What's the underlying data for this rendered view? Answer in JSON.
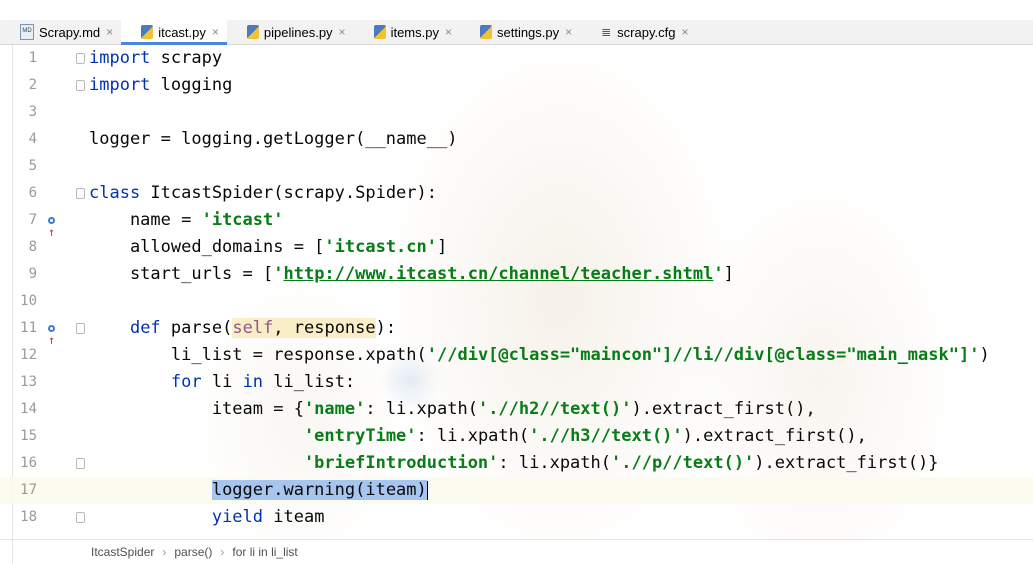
{
  "tabs": [
    {
      "label": "Scrapy.md",
      "icon": "markdown-file-icon",
      "icon_text": "MD",
      "active": false
    },
    {
      "label": "itcast.py",
      "icon": "python-file-icon",
      "active": true
    },
    {
      "label": "pipelines.py",
      "icon": "python-file-icon",
      "active": false
    },
    {
      "label": "items.py",
      "icon": "python-file-icon",
      "active": false
    },
    {
      "label": "settings.py",
      "icon": "python-file-icon",
      "active": false
    },
    {
      "label": "scrapy.cfg",
      "icon": "config-file-icon",
      "icon_text": "≣",
      "active": false
    }
  ],
  "tab_close_glyph": "×",
  "editor": {
    "lines": [
      {
        "num": "1",
        "parts": [
          {
            "t": "import",
            "c": "kw"
          },
          {
            "t": " scrapy",
            "c": ""
          }
        ]
      },
      {
        "num": "2",
        "parts": [
          {
            "t": "import",
            "c": "kw"
          },
          {
            "t": " logging",
            "c": ""
          }
        ]
      },
      {
        "num": "3",
        "parts": []
      },
      {
        "num": "4",
        "parts": [
          {
            "t": "logger = logging.getLogger(__name__)",
            "c": ""
          }
        ]
      },
      {
        "num": "5",
        "parts": []
      },
      {
        "num": "6",
        "parts": [
          {
            "t": "class",
            "c": "kw"
          },
          {
            "t": " ItcastSpider(scrapy.Spider):",
            "c": ""
          }
        ]
      },
      {
        "num": "7",
        "parts": [
          {
            "t": "    name = ",
            "c": ""
          },
          {
            "t": "'itcast'",
            "c": "str"
          }
        ]
      },
      {
        "num": "8",
        "parts": [
          {
            "t": "    allowed_domains = [",
            "c": ""
          },
          {
            "t": "'itcast.cn'",
            "c": "str"
          },
          {
            "t": "]",
            "c": ""
          }
        ]
      },
      {
        "num": "9",
        "parts": [
          {
            "t": "    start_urls = [",
            "c": ""
          },
          {
            "t": "'",
            "c": "str"
          },
          {
            "t": "http://www.itcast.cn/channel/teacher.shtml",
            "c": "url"
          },
          {
            "t": "'",
            "c": "str"
          },
          {
            "t": "]",
            "c": ""
          }
        ]
      },
      {
        "num": "10",
        "parts": []
      },
      {
        "num": "11",
        "parts": [
          {
            "t": "    ",
            "c": ""
          },
          {
            "t": "def",
            "c": "kw"
          },
          {
            "t": " parse(",
            "c": ""
          },
          {
            "t": "self",
            "c": "selfp"
          },
          {
            "t": ", response",
            "c": "param"
          },
          {
            "t": "):",
            "c": ""
          }
        ]
      },
      {
        "num": "12",
        "parts": [
          {
            "t": "        li_list = response.xpath(",
            "c": ""
          },
          {
            "t": "'//div[@class=\"maincon\"]//li//div[@class=\"main_mask\"]'",
            "c": "str"
          },
          {
            "t": ")",
            "c": ""
          }
        ]
      },
      {
        "num": "13",
        "parts": [
          {
            "t": "        ",
            "c": ""
          },
          {
            "t": "for",
            "c": "kw"
          },
          {
            "t": " li ",
            "c": ""
          },
          {
            "t": "in",
            "c": "kw"
          },
          {
            "t": " li_list:",
            "c": ""
          }
        ]
      },
      {
        "num": "14",
        "parts": [
          {
            "t": "            iteam = {",
            "c": ""
          },
          {
            "t": "'name'",
            "c": "str"
          },
          {
            "t": ": li.xpath(",
            "c": ""
          },
          {
            "t": "'.//h2//text()'",
            "c": "str"
          },
          {
            "t": ").extract_first(),",
            "c": ""
          }
        ]
      },
      {
        "num": "15",
        "parts": [
          {
            "t": "                     ",
            "c": ""
          },
          {
            "t": "'entryTime'",
            "c": "str"
          },
          {
            "t": ": li.xpath(",
            "c": ""
          },
          {
            "t": "'.//h3//text()'",
            "c": "str"
          },
          {
            "t": ").extract_first(),",
            "c": ""
          }
        ]
      },
      {
        "num": "16",
        "parts": [
          {
            "t": "                     ",
            "c": ""
          },
          {
            "t": "'briefIntroduction'",
            "c": "str"
          },
          {
            "t": ": li.xpath(",
            "c": ""
          },
          {
            "t": "'.//p//text()'",
            "c": "str"
          },
          {
            "t": ").extract_first()}",
            "c": ""
          }
        ]
      },
      {
        "num": "17",
        "parts": [
          {
            "t": "            ",
            "c": ""
          },
          {
            "t": "logger.warning(iteam)",
            "c": "sel"
          }
        ],
        "current": true,
        "caret": true
      },
      {
        "num": "18",
        "parts": [
          {
            "t": "            ",
            "c": ""
          },
          {
            "t": "yield",
            "c": "kw"
          },
          {
            "t": " iteam",
            "c": ""
          }
        ]
      }
    ],
    "markers": [
      {
        "line": "7",
        "icon": "override-method-icon",
        "glyph": "↑"
      },
      {
        "line": "11",
        "icon": "override-method-icon",
        "glyph": "↑"
      }
    ],
    "folds": [
      "1",
      "2",
      "6",
      "11",
      "16",
      "18"
    ]
  },
  "breadcrumb": [
    "ItcastSpider",
    "parse()",
    "for li in li_list"
  ],
  "breadcrumb_sep": "›"
}
